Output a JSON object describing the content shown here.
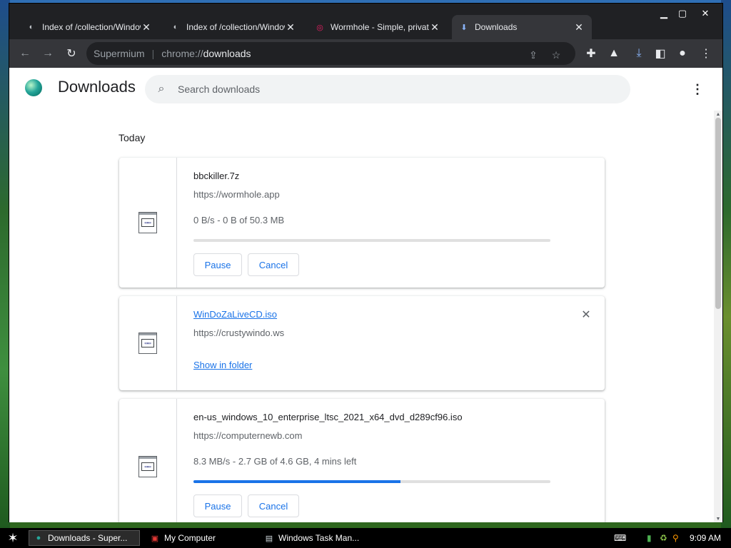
{
  "browser": {
    "tabs": [
      {
        "title": "Index of /collection/Window",
        "active": false,
        "icon": "document-icon"
      },
      {
        "title": "Index of /collection/Window",
        "active": false,
        "icon": "document-icon"
      },
      {
        "title": "Wormhole - Simple, private",
        "active": false,
        "icon": "wormhole-icon"
      },
      {
        "title": "Downloads",
        "active": true,
        "icon": "download-icon"
      }
    ],
    "window_controls": {
      "minimize": "▁",
      "maximize": "▢",
      "close": "✕"
    },
    "omnibox": {
      "site_label": "Supermium",
      "url_prefix": "chrome://",
      "url_path": "downloads"
    }
  },
  "downloads_page": {
    "title": "Downloads",
    "search_placeholder": "Search downloads",
    "section_label": "Today",
    "items": [
      {
        "filename": "bbckiller.7z",
        "source": "https://wormhole.app",
        "status": "0 B/s - 0 B of 50.3 MB",
        "progress": 0.0,
        "buttons": [
          "Pause",
          "Cancel"
        ]
      },
      {
        "filename": "WinDoZaLiveCD.iso",
        "source": "https://crustywindo.ws",
        "link_label": "Show in folder",
        "completed": true
      },
      {
        "filename": "en-us_windows_10_enterprise_ltsc_2021_x64_dvd_d289cf96.iso",
        "source": "https://computernewb.com",
        "status": "8.3 MB/s - 2.7 GB of 4.6 GB, 4 mins left",
        "progress": 0.58,
        "buttons": [
          "Pause",
          "Cancel"
        ]
      }
    ]
  },
  "taskbar": {
    "tasks": [
      {
        "label": "Downloads - Super...",
        "active": true
      },
      {
        "label": "My Computer",
        "active": false
      },
      {
        "label": "Windows Task Man...",
        "active": false
      }
    ],
    "clock": "9:09 AM"
  },
  "colors": {
    "accent": "#1a73e8",
    "chrome_dark": "#202124",
    "toolbar": "#35363a"
  }
}
